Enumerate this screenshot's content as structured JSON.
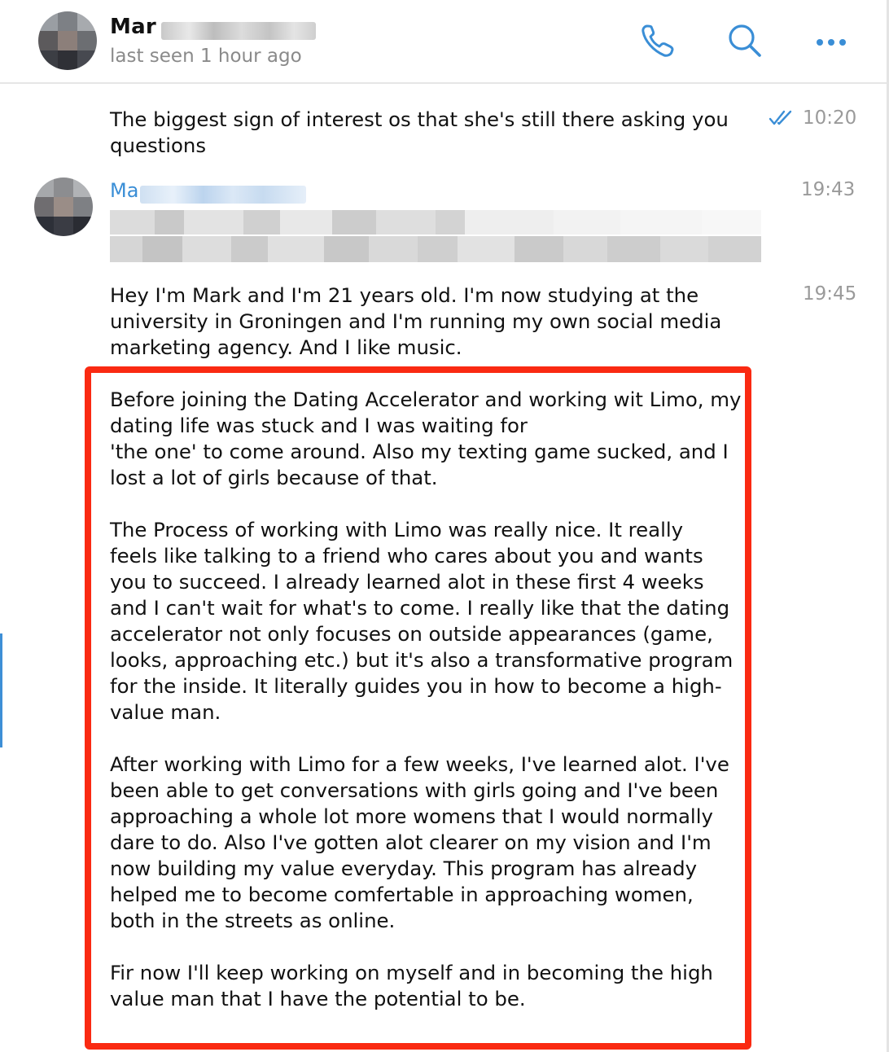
{
  "header": {
    "contact_name": "Mar",
    "last_seen": "last seen 1 hour ago",
    "icons": [
      "phone-icon",
      "search-icon",
      "more-icon"
    ]
  },
  "messages": [
    {
      "text": "The biggest sign of interest os that she's still there asking you\nquestions",
      "time": "10:20",
      "status": "read"
    },
    {
      "sender": "Ma",
      "time": "19:43"
    },
    {
      "text": "Hey I'm Mark and I'm 21 years old. I'm now studying at the\nuniversity in Groningen and I'm running my own social media\nmarketing agency. And I like music.",
      "time": "19:45"
    },
    {
      "text": "Before joining the Dating Accelerator and working wit Limo, my\ndating life was stuck and I was waiting for\n'the one' to come around. Also my texting game sucked, and I\nlost a lot of girls because of that.\n\nThe Process of working with Limo was really nice. It really\nfeels like talking to a friend who cares about you and wants\nyou to succeed. I already learned alot in these first 4 weeks\nand I can't wait for what's to come. I really like that the dating\naccelerator not only focuses on outside appearances (game,\nlooks, approaching etc.) but it's also a transformative program\nfor the inside. It literally guides you in how to become a high-\nvalue man.\n\nAfter working with Limo for a few weeks, I've learned alot. I've\nbeen able to get conversations with girls going and I've been\napproaching a whole lot more womens that I would normally\ndare to do. Also I've gotten alot clearer on my vision and I'm\nnow building my value everyday. This program has already\nhelped me to become comfertable in approaching women,\nboth in the streets as online.\n\nFir now I'll keep working on myself and in becoming the high\nvalue man that I have the potential to be."
    }
  ],
  "colors": {
    "accent": "#3a8ed6",
    "highlight": "#fa2a12",
    "muted": "#9a9a9a"
  }
}
